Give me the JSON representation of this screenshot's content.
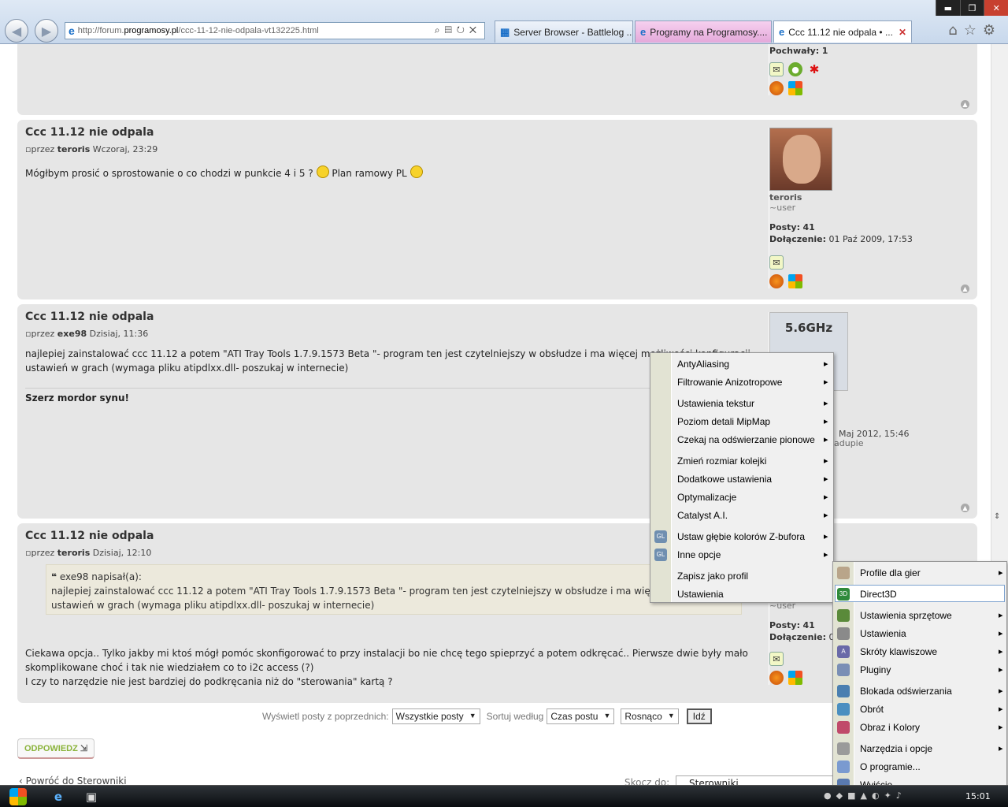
{
  "browser": {
    "url_prefix": "http://forum.",
    "url_domain": "programosy.pl",
    "url_path": "/ccc-11-12-nie-odpala-vt132225.html",
    "tabs": [
      {
        "label": "Server Browser - Battlelog ..."
      },
      {
        "label": "Programy na Programosy...."
      },
      {
        "label": "Ccc 11.12 nie odpala • ..."
      }
    ],
    "window_controls": {
      "minimize": "▬",
      "maximize": "❐",
      "close": "✕"
    },
    "toolbar_icons": [
      "home-icon",
      "star-icon",
      "gear-icon"
    ]
  },
  "posts": [
    {
      "profile": {
        "posts_thanks_label": "Pochwały:",
        "posts_thanks_value": "1"
      }
    },
    {
      "title": "Ccc 11.12 nie odpala",
      "by": "przez",
      "author": "teroris",
      "date": "Wczoraj, 23:29",
      "body_part1": "Mógłbym prosić o sprostowanie o co chodzi w punkcie 4 i 5 ?",
      "body_part2": "Plan ramowy PL",
      "profile": {
        "username": "teroris",
        "rank": "~user",
        "posts_label": "Posty:",
        "posts_value": "41",
        "joined_label": "Dołączenie:",
        "joined_value": "01 Paź 2009, 17:53"
      }
    },
    {
      "title": "Ccc 11.12 nie odpala",
      "by": "przez",
      "author": "exe98",
      "date": "Dzisiaj, 11:36",
      "body_line1": "najlepiej zainstalować ccc 11.12 a potem \"ATI Tray Tools 1.7.9.1573 Beta \"- program ten jest czytelniejszy w obsłudze i ma więcej możliwości konfiguracji",
      "body_line2": "ustawień w grach (wymaga pliku atipdlxx.dll- poszukaj w internecie)",
      "signature": "Szerz mordor synu!",
      "profile": {
        "avatar_text": "5.6GHz",
        "joined_value": "Maj 2012, 15:46",
        "location": "adupie"
      }
    },
    {
      "title": "Ccc 11.12 nie odpala",
      "by": "przez",
      "author": "teroris",
      "date": "Dzisiaj, 12:10",
      "quote_author": "exe98 napisał(a):",
      "quote_line1": "najlepiej zainstalować ccc 11.12 a potem \"ATI Tray Tools 1.7.9.1573 Beta \"- program ten jest czytelniejszy w obsłudze i ma więcej możliwości",
      "quote_line2": "ustawień w grach (wymaga pliku atipdlxx.dll- poszukaj w internecie)",
      "body_line1": "Ciekawa opcja.. Tylko jakby mi ktoś mógł pomóc skonfigorować to przy instalacji bo nie chcę tego spieprzyć a potem odkręcać.. Pierwsze dwie były mało",
      "body_line2": "skomplikowane choć i tak nie wiedziałem co to i2c access (?)",
      "body_line3": "I czy to narzędzie nie jest bardziej do podkręcania niż do \"sterowania\" kartą ?",
      "profile": {
        "rank": "~user",
        "posts_label": "Posty:",
        "posts_value": "41",
        "joined_label": "Dołączenie:",
        "joined_value": "01"
      }
    }
  ],
  "sortbar": {
    "show_label": "Wyświetl posty z poprzednich:",
    "show_value": "Wszystkie posty",
    "sort_label": "Sortuj według",
    "sort_value": "Czas postu",
    "order_value": "Rosnąco",
    "go_label": "Idź"
  },
  "reply_label": "ODPOWIEDZ",
  "back_link": "Powróć do Sterowniki",
  "jump_label": "Skocz do:",
  "jump_value": "Sterowniki",
  "submenu": [
    {
      "label": "AntyAliasing",
      "sub": true
    },
    {
      "label": "Filtrowanie Anizotropowe",
      "sub": true
    },
    {
      "label": "Ustawienia tekstur",
      "sub": true
    },
    {
      "label": "Poziom detali MipMap",
      "sub": true
    },
    {
      "label": "Czekaj na odświerzanie pionowe",
      "sub": true
    },
    {
      "label": "Zmień rozmiar kolejki",
      "sub": true
    },
    {
      "label": "Dodatkowe ustawienia",
      "sub": true
    },
    {
      "label": "Optymalizacje",
      "sub": true
    },
    {
      "label": "Catalyst A.I.",
      "sub": true
    },
    {
      "label": "Ustaw głębie kolorów Z-bufora",
      "sub": true,
      "icon": "GL"
    },
    {
      "label": "Inne opcje",
      "sub": true,
      "icon": "GL"
    },
    {
      "label": "Zapisz jako profil",
      "sub": false
    },
    {
      "label": "Ustawienia",
      "sub": false
    }
  ],
  "traymenu": [
    {
      "label": "Profile dla gier",
      "sub": true
    },
    {
      "label": "Direct3D",
      "sub": false,
      "icon": "3D"
    },
    {
      "label": "Ustawienia sprzętowe",
      "sub": true
    },
    {
      "label": "Ustawienia",
      "sub": true
    },
    {
      "label": "Skróty klawiszowe",
      "sub": true,
      "icon": "A"
    },
    {
      "label": "Pluginy",
      "sub": true
    },
    {
      "label": "Blokada odświerzania",
      "sub": true
    },
    {
      "label": "Obrót",
      "sub": true
    },
    {
      "label": "Obraz i Kolory",
      "sub": true
    },
    {
      "label": "Narzędzia i opcje",
      "sub": true
    },
    {
      "label": "O programie...",
      "sub": false
    },
    {
      "label": "Wyjście",
      "sub": false
    }
  ],
  "taskbar": {
    "clock": "15:01"
  },
  "colors": {
    "accent": "#8ab33a",
    "menu_bg": "#f0f0f0",
    "post_bg": "#e6e6e6"
  }
}
